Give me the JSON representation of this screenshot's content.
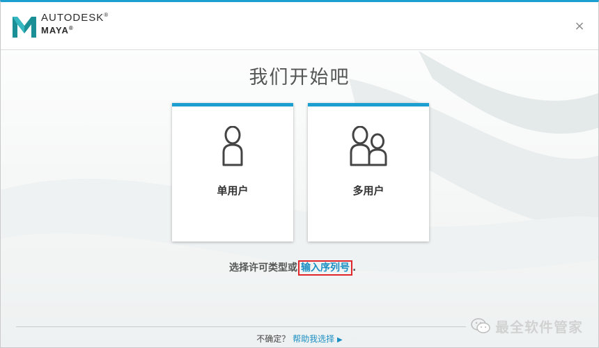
{
  "window": {
    "brand": "AUTODESK",
    "product": "MAYA",
    "trademark": "®",
    "close_symbol": "×"
  },
  "main": {
    "title": "我们开始吧",
    "cards": [
      {
        "label": "单用户",
        "icon": "single-user-icon"
      },
      {
        "label": "多用户",
        "icon": "multi-user-icon"
      }
    ],
    "prompt_text": "选择许可类型或",
    "serial_link": "输入序列号",
    "prompt_end": "."
  },
  "footer": {
    "question": "不确定？",
    "help_link": "帮助我选择",
    "arrow": "▶"
  },
  "watermark": {
    "text": "最全软件管家",
    "icon": "wechat-icon"
  },
  "colors": {
    "accent": "#1b9fd1",
    "link": "#1b8fc4",
    "highlight_box": "#e0262b"
  }
}
